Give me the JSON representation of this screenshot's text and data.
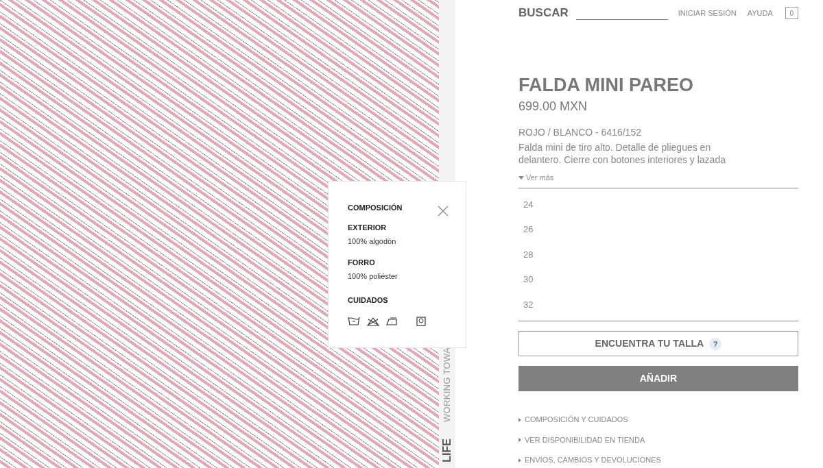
{
  "header": {
    "search_label": "BUSCAR",
    "links": [
      "INICIAR SESIÓN",
      "AYUDA"
    ],
    "cart_count": "0"
  },
  "side_text": {
    "tagline": "WORKING TOWA",
    "brand": "LIFE"
  },
  "composition_popup": {
    "title": "COMPOSICIÓN",
    "sections": [
      {
        "heading": "EXTERIOR",
        "text": "100% algodón"
      },
      {
        "heading": "FORRO",
        "text": "100% poliéster"
      }
    ],
    "care_heading": "CUIDADOS"
  },
  "product": {
    "name": "FALDA MINI PAREO",
    "price": "699.00 MXN",
    "color_ref": "ROJO / BLANCO - 6416/152",
    "description": "Falda mini de tiro alto. Detalle de pliegues en delantero. Cierre con botones interiores y lazada",
    "more": "Ver más",
    "sizes": [
      "24",
      "26",
      "28",
      "30",
      "32"
    ],
    "find_size": "ENCUENTRA TU TALLA",
    "help": "?",
    "add": "AÑADIR",
    "links": [
      "COMPOSICIÓN Y CUIDADOS",
      "VER DISPONIBILIDAD EN TIENDA",
      "ENVÍOS, CAMBIOS Y DEVOLUCIONES"
    ]
  }
}
